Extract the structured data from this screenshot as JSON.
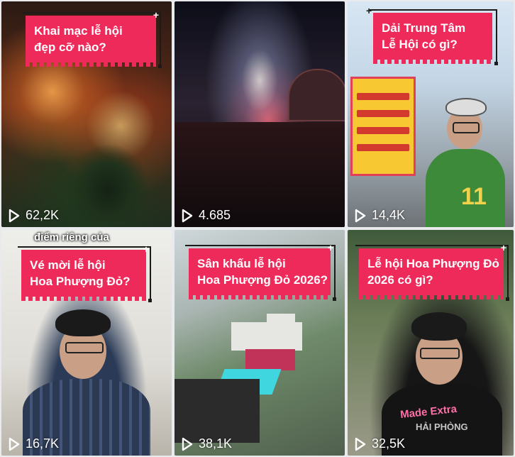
{
  "videos": [
    {
      "title_lines": [
        "Khai mạc lễ hội",
        "đẹp cỡ nào?"
      ],
      "views": "62,2K",
      "play_icon": "play-outline-icon"
    },
    {
      "title_lines": [],
      "views": "4.685",
      "play_icon": "play-outline-icon"
    },
    {
      "title_lines": [
        "Dải Trung Tâm",
        "Lễ Hội có gì?"
      ],
      "views": "14,4K",
      "play_icon": "play-outline-icon",
      "shirt_number": "11"
    },
    {
      "title_lines": [
        "Vé mời lễ hội",
        "Hoa Phượng Đỏ?"
      ],
      "views": "16,7K",
      "play_icon": "play-outline-icon",
      "overlay_text": "điểm riêng của"
    },
    {
      "title_lines": [
        "Sân khấu lễ hội",
        "Hoa Phượng Đỏ 2026?"
      ],
      "views": "38,1K",
      "play_icon": "play-outline-icon"
    },
    {
      "title_lines": [
        "Lễ hội Hoa Phượng Đỏ",
        "2026 có gì?"
      ],
      "views": "32,5K",
      "play_icon": "play-outline-icon",
      "shirt_text": "Made Extra",
      "watermark": "HẢI PHÒNG"
    }
  ],
  "colors": {
    "card": "#ee2a5a",
    "card_border": "#1b1b1b",
    "text": "#ffffff"
  }
}
